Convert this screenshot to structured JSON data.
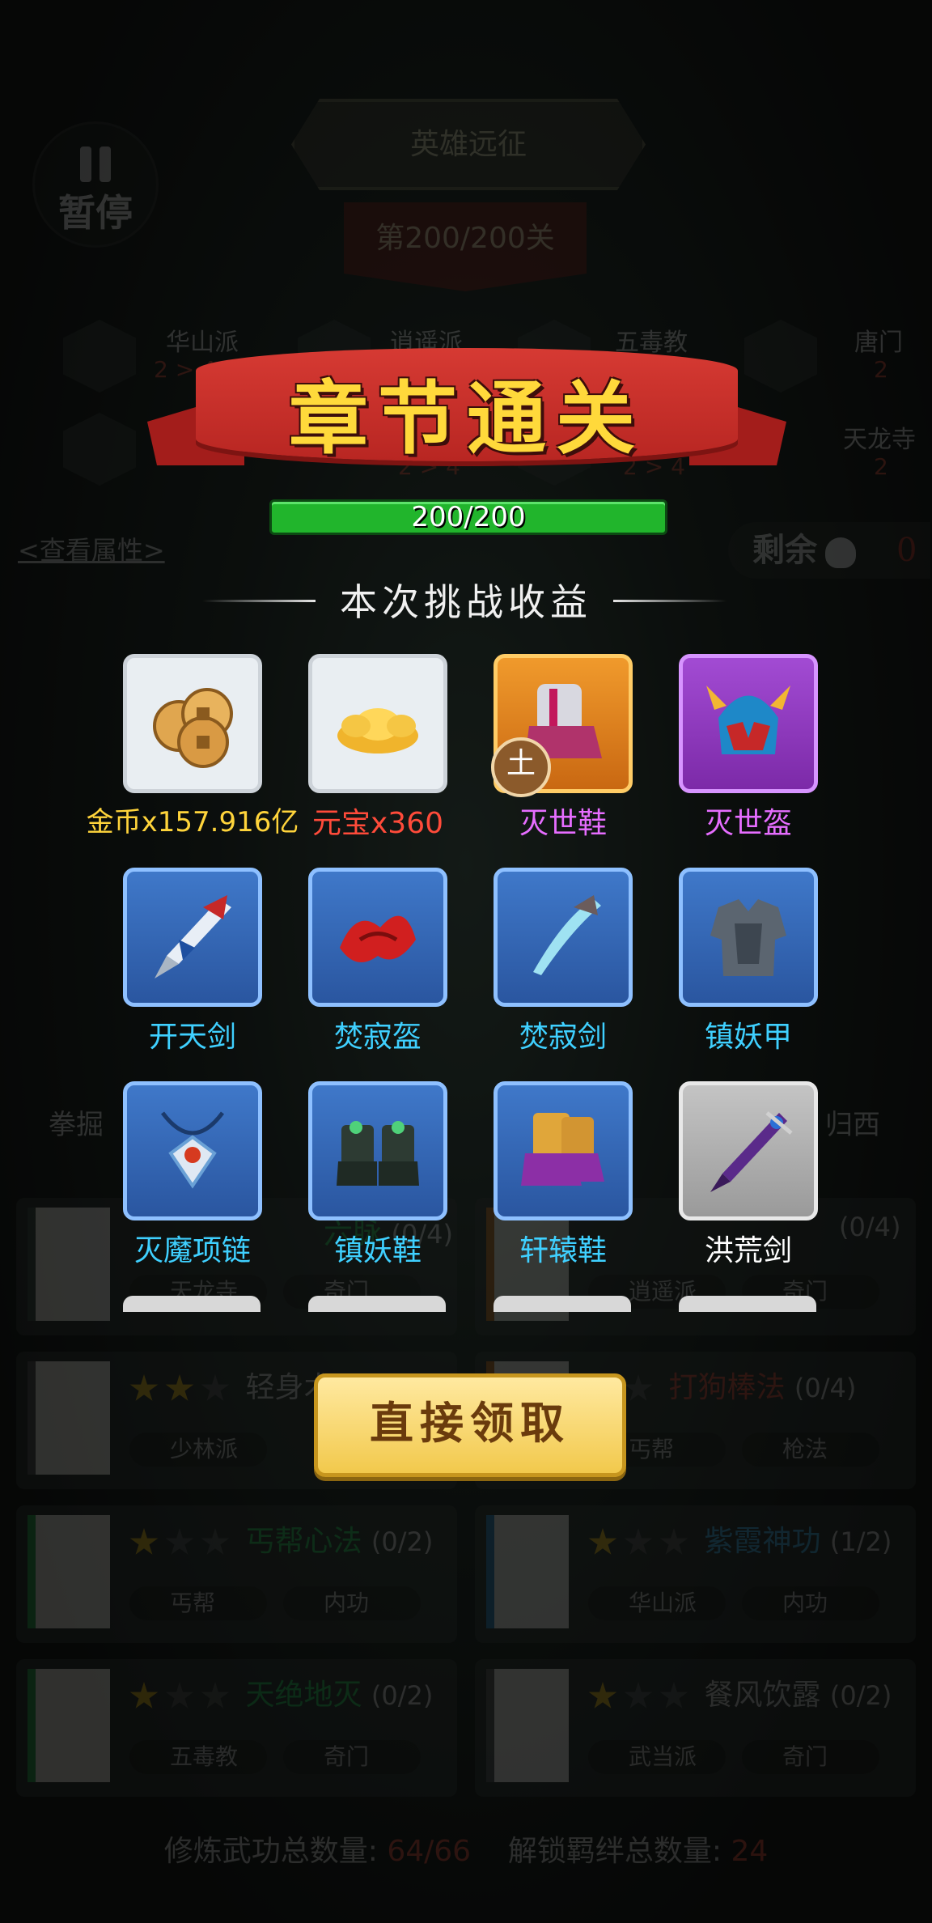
{
  "background": {
    "pause_label": "暂停",
    "mode_title": "英雄远征",
    "stage_label": "第200/200关",
    "sects": [
      {
        "name": "华山派",
        "value": "2 > 4"
      },
      {
        "name": "逍遥派",
        "value": ""
      },
      {
        "name": "五毒教",
        "value": ""
      },
      {
        "name": "唐门",
        "value": "2"
      },
      {
        "name": "",
        "value": "2 > 4"
      },
      {
        "name": "",
        "value": "2 > 4"
      },
      {
        "name": "天龙寺",
        "value": "2"
      }
    ],
    "view_attributes": "<查看属性>",
    "remaining_label": "剩余",
    "remaining_value": "0",
    "skill_tabs": [
      "拳掘",
      "归西"
    ],
    "skills": [
      {
        "title": "轻身术",
        "count": "",
        "tags": [
          "少林派",
          ""
        ],
        "stars": 2,
        "book": "轻身术"
      },
      {
        "title": "打狗棒法",
        "count": "(0/4)",
        "tags": [
          "丐帮",
          "枪法"
        ],
        "stars": 1,
        "book": "打狗棒法"
      },
      {
        "title": "丐帮心法",
        "count": "(0/2)",
        "tags": [
          "丐帮",
          "内功"
        ],
        "stars": 1,
        "book": "丐帮心法"
      },
      {
        "title": "紫霞神功",
        "count": "(1/2)",
        "tags": [
          "华山派",
          "内功"
        ],
        "stars": 1,
        "book": "紫霞神功"
      },
      {
        "title": "天绝地灭",
        "count": "(0/2)",
        "tags": [
          "五毒教",
          "奇门"
        ],
        "stars": 1,
        "book": "天绝地灭"
      },
      {
        "title": "餐风饮露",
        "count": "(0/2)",
        "tags": [
          "武当派",
          "奇门"
        ],
        "stars": 1,
        "book": "餐风饮露"
      }
    ],
    "partial_row": {
      "left_title": "六脉",
      "left_count": "(0/4)",
      "right_count": "(0/4)",
      "tags": [
        "天龙寺",
        "奇门",
        "逍遥派",
        "奇门"
      ]
    },
    "totals": {
      "label1": "修炼武功总数量:",
      "value1": "64/66",
      "label2": "解锁羁绊总数量:",
      "value2": "24"
    }
  },
  "overlay": {
    "banner_title": "章节通关",
    "progress_text": "200/200",
    "progress_fraction": 1.0,
    "rewards_title": "本次挑战收益",
    "rewards": [
      {
        "label": "金币x157.916亿",
        "rarity": "white",
        "color": "#ffd43b",
        "icon": "coins-icon"
      },
      {
        "label": "元宝x360",
        "rarity": "white",
        "color": "#ff4b3a",
        "icon": "gold-ingot-icon"
      },
      {
        "label": "灭世鞋",
        "rarity": "orange",
        "color": "#e66dff",
        "icon": "boots-icon",
        "badge": "土"
      },
      {
        "label": "灭世盔",
        "rarity": "purple",
        "color": "#e66dff",
        "icon": "helmet-icon"
      },
      {
        "label": "开天剑",
        "rarity": "blue",
        "color": "#3fd0ff",
        "icon": "sword-icon"
      },
      {
        "label": "焚寂盔",
        "rarity": "blue",
        "color": "#3fd0ff",
        "icon": "red-helmet-icon"
      },
      {
        "label": "焚寂剑",
        "rarity": "blue",
        "color": "#3fd0ff",
        "icon": "curved-sword-icon"
      },
      {
        "label": "镇妖甲",
        "rarity": "blue",
        "color": "#3fd0ff",
        "icon": "armor-icon"
      },
      {
        "label": "灭魔项链",
        "rarity": "blue",
        "color": "#3fd0ff",
        "icon": "necklace-icon"
      },
      {
        "label": "镇妖鞋",
        "rarity": "blue",
        "color": "#3fd0ff",
        "icon": "green-boots-icon"
      },
      {
        "label": "轩辕鞋",
        "rarity": "blue",
        "color": "#3fd0ff",
        "icon": "purple-boots-icon"
      },
      {
        "label": "洪荒剑",
        "rarity": "grey",
        "color": "#ffffff",
        "icon": "dark-sword-icon"
      }
    ],
    "claim_button": "直接领取"
  }
}
